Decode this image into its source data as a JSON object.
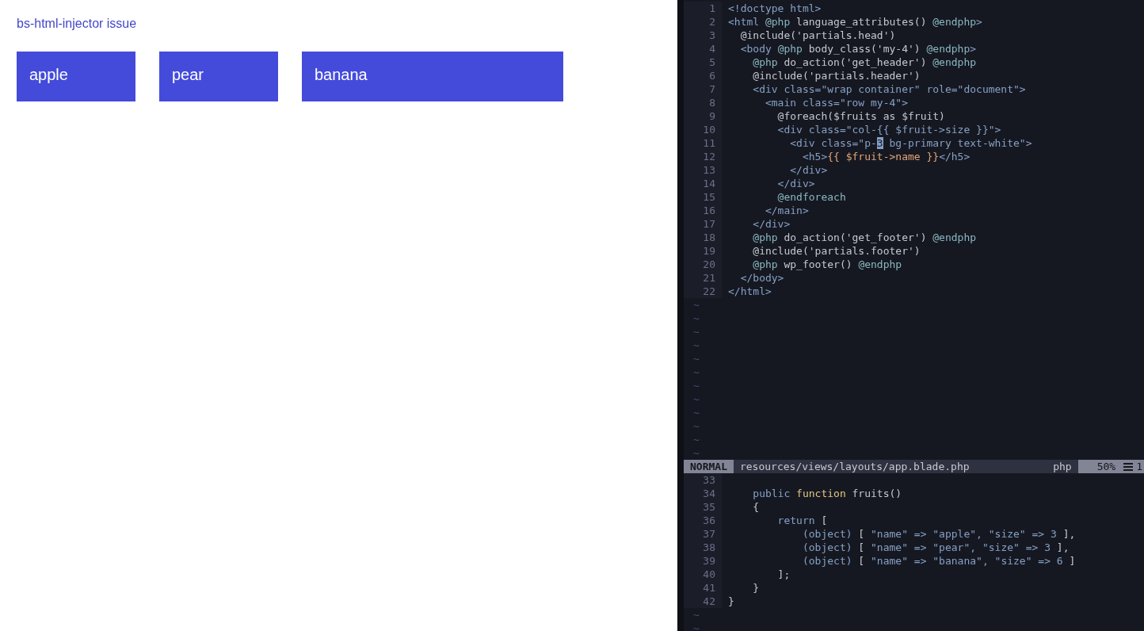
{
  "preview": {
    "title": "bs-html-injector issue",
    "fruits": [
      {
        "name": "apple",
        "kind": "narrow"
      },
      {
        "name": "pear",
        "kind": "narrow"
      },
      {
        "name": "banana",
        "kind": "wide"
      }
    ]
  },
  "editor": {
    "top_pane": {
      "lines": [
        {
          "number": "1",
          "tokens": [
            {
              "text": "<!doctype html>",
              "kind": "tag"
            }
          ]
        },
        {
          "number": "2",
          "tokens": [
            {
              "text": "<html ",
              "kind": "tag"
            },
            {
              "text": "@php",
              "kind": "directive"
            },
            {
              "text": " language_attributes() ",
              "kind": "plain"
            },
            {
              "text": "@endphp",
              "kind": "directive"
            },
            {
              "text": ">",
              "kind": "tag"
            }
          ]
        },
        {
          "number": "3",
          "tokens": [
            {
              "text": "  @include('partials.head')",
              "kind": "plain"
            }
          ]
        },
        {
          "number": "4",
          "tokens": [
            {
              "text": "  <body ",
              "kind": "tag"
            },
            {
              "text": "@php",
              "kind": "directive"
            },
            {
              "text": " body_class('my-4') ",
              "kind": "plain"
            },
            {
              "text": "@endphp",
              "kind": "directive"
            },
            {
              "text": ">",
              "kind": "tag"
            }
          ]
        },
        {
          "number": "5",
          "tokens": [
            {
              "text": "    @php",
              "kind": "directive"
            },
            {
              "text": " do_action('get_header') ",
              "kind": "plain"
            },
            {
              "text": "@endphp",
              "kind": "directive"
            }
          ]
        },
        {
          "number": "6",
          "tokens": [
            {
              "text": "    @include('partials.header')",
              "kind": "plain"
            }
          ]
        },
        {
          "number": "7",
          "tokens": [
            {
              "text": "    <div class=\"wrap container\" role=\"document\">",
              "kind": "tag"
            }
          ]
        },
        {
          "number": "8",
          "tokens": [
            {
              "text": "      <main class=\"row my-4\">",
              "kind": "tag"
            }
          ]
        },
        {
          "number": "9",
          "tokens": [
            {
              "text": "        @foreach($fruits as $fruit)",
              "kind": "plain"
            }
          ]
        },
        {
          "number": "10",
          "tokens": [
            {
              "text": "        <div class=\"col-{{ $fruit->size }}\">",
              "kind": "tag"
            }
          ]
        },
        {
          "number": "11",
          "tokens": [
            {
              "text": "          <div class=\"p-",
              "kind": "tag"
            },
            {
              "text": "3",
              "kind": "cursor"
            },
            {
              "text": " bg-primary text-white\">",
              "kind": "tag"
            }
          ]
        },
        {
          "number": "12",
          "tokens": [
            {
              "text": "            <h5>",
              "kind": "tag"
            },
            {
              "text": "{{ $fruit->name }}",
              "kind": "echo"
            },
            {
              "text": "</h5>",
              "kind": "tag"
            }
          ]
        },
        {
          "number": "13",
          "tokens": [
            {
              "text": "          </div>",
              "kind": "tag"
            }
          ]
        },
        {
          "number": "14",
          "tokens": [
            {
              "text": "        </div>",
              "kind": "tag"
            }
          ]
        },
        {
          "number": "15",
          "tokens": [
            {
              "text": "        @endforeach",
              "kind": "directive"
            }
          ]
        },
        {
          "number": "16",
          "tokens": [
            {
              "text": "      </main>",
              "kind": "tag"
            }
          ]
        },
        {
          "number": "17",
          "tokens": [
            {
              "text": "    </div>",
              "kind": "tag"
            }
          ]
        },
        {
          "number": "18",
          "tokens": [
            {
              "text": "    @php",
              "kind": "directive"
            },
            {
              "text": " do_action('get_footer') ",
              "kind": "plain"
            },
            {
              "text": "@endphp",
              "kind": "directive"
            }
          ]
        },
        {
          "number": "19",
          "tokens": [
            {
              "text": "    @include('partials.footer')",
              "kind": "plain"
            }
          ]
        },
        {
          "number": "20",
          "tokens": [
            {
              "text": "    @php",
              "kind": "directive"
            },
            {
              "text": " wp_footer() ",
              "kind": "plain"
            },
            {
              "text": "@endphp",
              "kind": "directive"
            }
          ]
        },
        {
          "number": "21",
          "tokens": [
            {
              "text": "  </body>",
              "kind": "tag"
            }
          ]
        },
        {
          "number": "22",
          "tokens": [
            {
              "text": "</html>",
              "kind": "tag"
            }
          ]
        }
      ],
      "filler": [
        "~",
        "~",
        "~",
        "~",
        "~",
        "~",
        "~",
        "~",
        "~",
        "~",
        "~",
        "~"
      ]
    },
    "status_bar": {
      "mode": "NORMAL",
      "file": "resources/views/layouts/app.blade.php",
      "filetype": "php",
      "percent": "50%",
      "column": "1"
    },
    "bottom_pane": {
      "lines": [
        {
          "number": "33"
        },
        {
          "number": "34",
          "tokens": [
            {
              "text": "    public ",
              "kind": "tag"
            },
            {
              "text": "function",
              "kind": "keyword"
            },
            {
              "text": " fruits()",
              "kind": "plain"
            }
          ]
        },
        {
          "number": "35",
          "tokens": [
            {
              "text": "    {",
              "kind": "plain"
            }
          ]
        },
        {
          "number": "36",
          "tokens": [
            {
              "text": "        return",
              "kind": "tag"
            },
            {
              "text": " [",
              "kind": "plain"
            }
          ]
        },
        {
          "number": "37",
          "tokens": [
            {
              "text": "            (object)",
              "kind": "tag"
            },
            {
              "text": " [ ",
              "kind": "plain"
            },
            {
              "text": "\"name\" => \"apple\", \"size\" => 3",
              "kind": "tag"
            },
            {
              "text": " ],",
              "kind": "plain"
            }
          ]
        },
        {
          "number": "38",
          "tokens": [
            {
              "text": "            (object)",
              "kind": "tag"
            },
            {
              "text": " [ ",
              "kind": "plain"
            },
            {
              "text": "\"name\" => \"pear\", \"size\" => 3",
              "kind": "tag"
            },
            {
              "text": " ],",
              "kind": "plain"
            }
          ]
        },
        {
          "number": "39",
          "tokens": [
            {
              "text": "            (object)",
              "kind": "tag"
            },
            {
              "text": " [ ",
              "kind": "plain"
            },
            {
              "text": "\"name\" => \"banana\", \"size\" => 6",
              "kind": "tag"
            },
            {
              "text": " ]",
              "kind": "plain"
            }
          ]
        },
        {
          "number": "40",
          "tokens": [
            {
              "text": "        ];",
              "kind": "plain"
            }
          ]
        },
        {
          "number": "41",
          "tokens": [
            {
              "text": "    }",
              "kind": "plain"
            }
          ]
        },
        {
          "number": "42",
          "tokens": [
            {
              "text": "}",
              "kind": "plain"
            }
          ]
        }
      ],
      "filler": [
        "~",
        "~"
      ]
    }
  }
}
